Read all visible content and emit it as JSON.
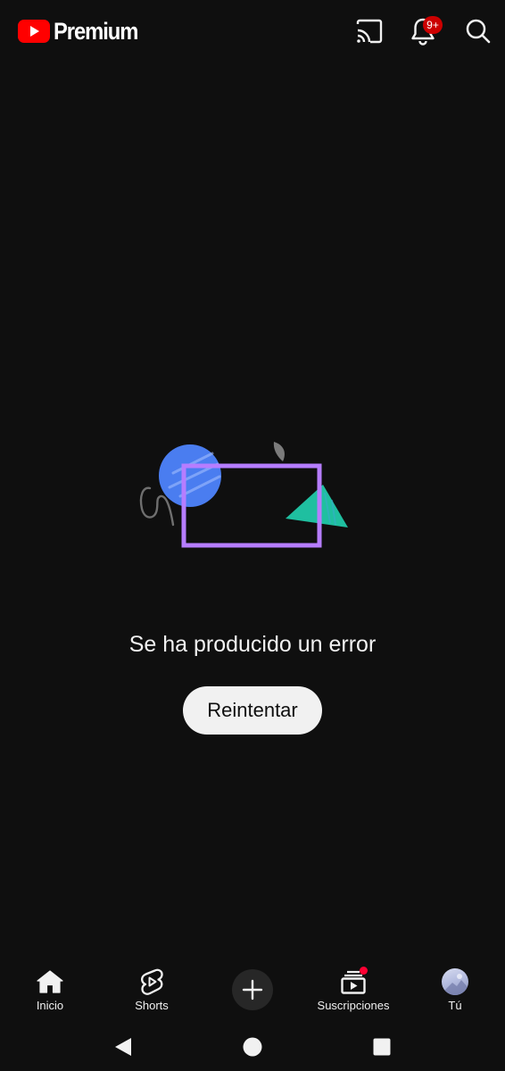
{
  "header": {
    "logo_text": "Premium",
    "notification_badge": "9+",
    "icons": [
      "youtube-logo-icon",
      "cast-icon",
      "bell-icon",
      "search-icon"
    ]
  },
  "main": {
    "error_message": "Se ha producido un error",
    "retry_label": "Reintentar"
  },
  "bottom_nav": {
    "items": [
      {
        "label": "Inicio",
        "icon": "home-icon"
      },
      {
        "label": "Shorts",
        "icon": "shorts-icon"
      },
      {
        "label": "",
        "icon": "plus-icon"
      },
      {
        "label": "Suscripciones",
        "icon": "subscriptions-icon"
      },
      {
        "label": "Tú",
        "icon": "avatar"
      }
    ]
  },
  "system_nav": {
    "icons": [
      "back-icon",
      "home-circle-icon",
      "recents-icon"
    ]
  },
  "colors": {
    "background": "#0f0f0f",
    "youtube_red": "#ff0000",
    "badge_red": "#cc0000",
    "text_primary": "#f1f1f1",
    "button_bg": "#f1f1f1",
    "illustration_blue": "#4a7df0",
    "illustration_purple": "#b67dff",
    "illustration_teal": "#1fbfa0"
  }
}
